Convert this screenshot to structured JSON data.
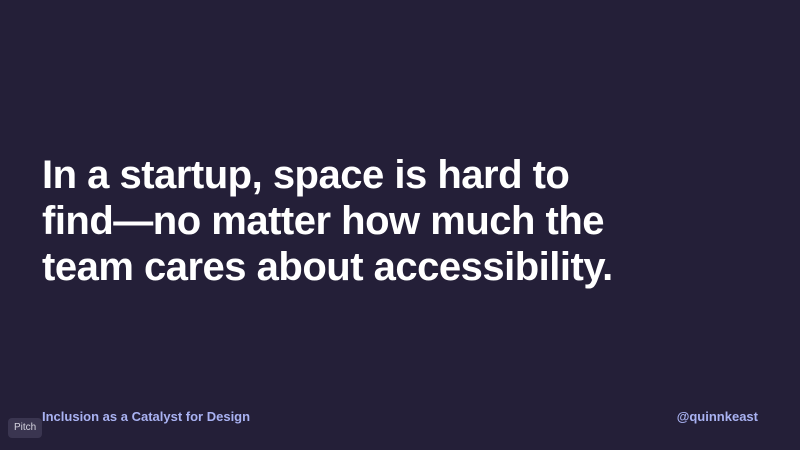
{
  "slide": {
    "headline_lines": [
      "In a startup, space is hard to",
      "find—no matter how much the",
      "team cares about accessibility."
    ],
    "footer_title": "Inclusion as a Catalyst for Design",
    "footer_handle": "@quinnkeast",
    "brand_badge": "Pitch"
  },
  "colors": {
    "background": "#241f38",
    "headline": "#ffffff",
    "footer_accent": "#a9b2f2"
  }
}
